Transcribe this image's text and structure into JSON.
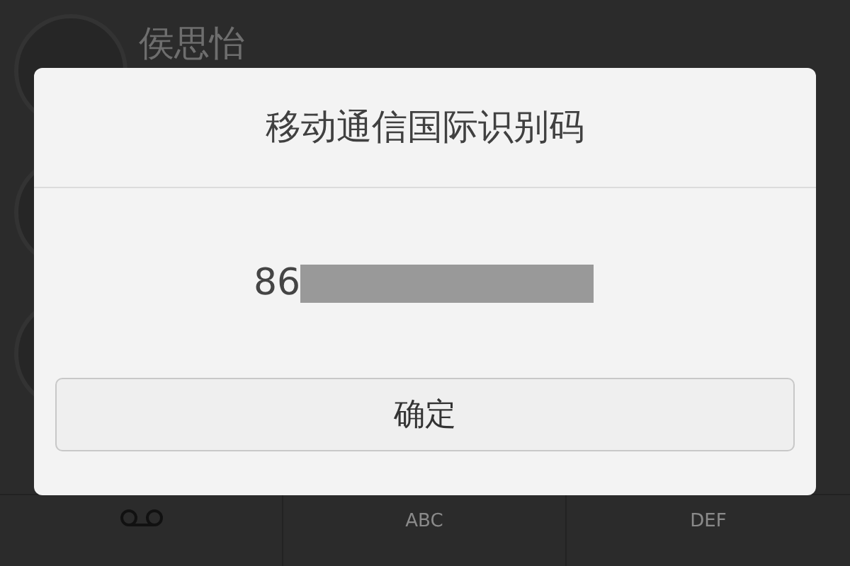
{
  "contacts": [
    {
      "name": "侯思怡"
    }
  ],
  "dialog": {
    "title": "移动通信国际识别码",
    "value": "86",
    "redacted": true,
    "button": "确定"
  },
  "keypad": [
    {
      "kind": "voicemail"
    },
    {
      "kind": "letters",
      "label": "ABC"
    },
    {
      "kind": "letters",
      "label": "DEF"
    }
  ]
}
